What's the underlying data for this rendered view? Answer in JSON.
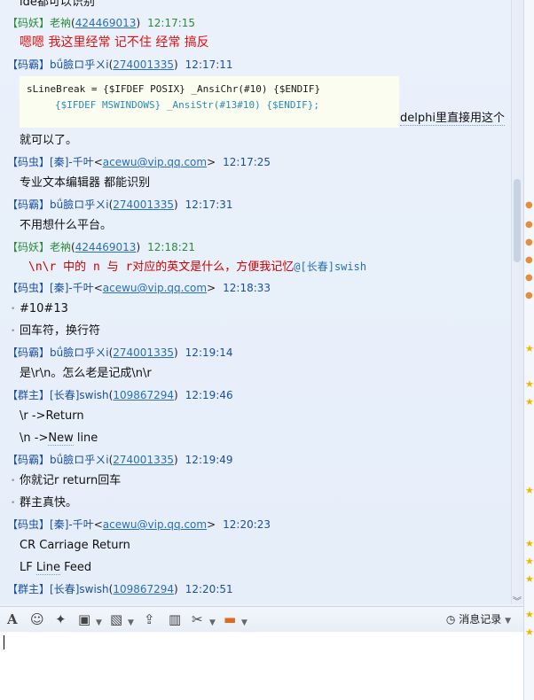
{
  "chat": {
    "top_fragment": "ide都可以识别",
    "messages": [
      {
        "role": "【码妖】",
        "name": "老衲",
        "id": "424469013",
        "time": "12:17:15",
        "color": "green"
      },
      {
        "role": "【码霸】",
        "name": "bǘ臉ロ乎ㄨi",
        "id": "274001335",
        "time": "12:17:11",
        "color": "blue"
      },
      {
        "role": "【码虫】",
        "name": "[秦]-千叶",
        "id": "acewu@vip.qq.com",
        "time": "12:17:25",
        "color": "blue",
        "bracket": true
      },
      {
        "role": "【码霸】",
        "name": "bǘ臉ロ乎ㄨi",
        "id": "274001335",
        "time": "12:17:31",
        "color": "blue"
      },
      {
        "role": "【码妖】",
        "name": "老衲",
        "id": "424469013",
        "time": "12:18:21",
        "color": "green"
      },
      {
        "role": "【码虫】",
        "name": "[秦]-千叶",
        "id": "acewu@vip.qq.com",
        "time": "12:18:33",
        "color": "blue",
        "bracket": true
      },
      {
        "role": "【码霸】",
        "name": "bǘ臉ロ乎ㄨi",
        "id": "274001335",
        "time": "12:19:14",
        "color": "blue"
      },
      {
        "role": "【群主】",
        "name": "[长春]swish",
        "id": "109867294",
        "time": "12:19:46",
        "color": "blue"
      },
      {
        "role": "【码霸】",
        "name": "bǘ臉ロ乎ㄨi",
        "id": "274001335",
        "time": "12:19:49",
        "color": "blue"
      },
      {
        "role": "【码虫】",
        "name": "[秦]-千叶",
        "id": "acewu@vip.qq.com",
        "time": "12:20:23",
        "color": "blue",
        "bracket": true
      },
      {
        "role": "【群主】",
        "name": "[长春]swish",
        "id": "109867294",
        "time": "12:20:51",
        "color": "blue"
      }
    ],
    "lines": {
      "l1": "嗯嗯 我这里经常 记不住 经常 搞反",
      "code1": "sLineBreak = {$IFDEF POSIX} _AnsiChr(#10) {$ENDIF}",
      "code2": "{$IFDEF MSWINDOWS} _AnsiStr(#13#10) {$ENDIF};",
      "code_tail": "delphi里直接用这个",
      "l2": "就可以了。",
      "l3": "专业文本编辑器 都能识别",
      "l4": "不用想什么平台。",
      "l5": "\\n\\r 中的 n 与 r对应的英文是什么，方便我记忆",
      "l5_mention": "@[长春]swish",
      "l6": "#10#13",
      "l7": "回车符，换行符",
      "l8": "是\\r\\n。怎么老是记成\\n\\r",
      "l9": "\\r ->Return",
      "l10_a": "\\n ->",
      "l10_b": "New",
      "l10_c": " line",
      "l11": "你就记r  return回车",
      "l12": "群主真快。",
      "l13": "CR Carriage Return",
      "l14_a": "LF ",
      "l14_b": "Line",
      "l14_c": " Feed"
    }
  },
  "toolbar": {
    "icons": [
      "font-icon",
      "emoji-icon",
      "magic-icon",
      "screenshot-icon",
      "image-icon",
      "upload-icon",
      "gift-icon",
      "scissors-icon",
      "chat-bubble-icon"
    ],
    "history_label": "消息记录"
  },
  "colors": {
    "accent": "#1b4f9c",
    "green": "#2c8a3c",
    "red": "#d11111",
    "link": "#2a6fb8"
  }
}
